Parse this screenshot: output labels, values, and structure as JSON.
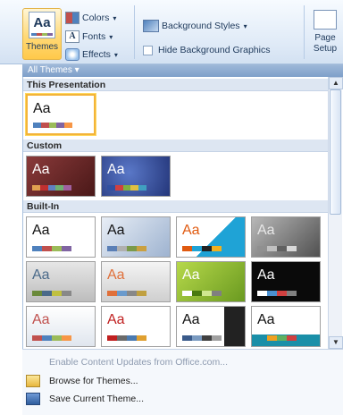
{
  "ribbon": {
    "themes_label": "Themes",
    "themes_icon_text": "Aa",
    "colors_label": "Colors",
    "fonts_label": "Fonts",
    "fonts_icon_text": "A",
    "effects_label": "Effects",
    "background_styles_label": "Background Styles",
    "hide_background_label": "Hide Background Graphics",
    "page_setup_line1": "Page",
    "page_setup_line2": "Setup",
    "all_themes_label": "All Themes"
  },
  "gallery": {
    "sections": [
      {
        "title": "This Presentation"
      },
      {
        "title": "Custom"
      },
      {
        "title": "Built-In"
      }
    ],
    "thumb_text": "Aa"
  },
  "menu": {
    "enable_updates": "Enable Content Updates from Office.com...",
    "browse": "Browse for Themes...",
    "save": "Save Current Theme..."
  },
  "icons": {
    "scroll_up": "▲",
    "scroll_down": "▼",
    "dropdown": "▾",
    "scroll_grip": "≡"
  }
}
